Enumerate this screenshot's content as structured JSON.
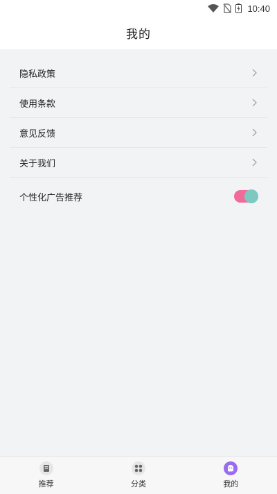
{
  "status_bar": {
    "time": "10:40"
  },
  "header": {
    "title": "我的"
  },
  "menu": {
    "items": [
      {
        "label": "隐私政策"
      },
      {
        "label": "使用条款"
      },
      {
        "label": "意见反馈"
      },
      {
        "label": "关于我们"
      }
    ],
    "toggle": {
      "label": "个性化广告推荐",
      "on": true
    }
  },
  "tabbar": {
    "tabs": [
      {
        "label": "推荐",
        "icon": "book-icon"
      },
      {
        "label": "分类",
        "icon": "grid-icon"
      },
      {
        "label": "我的",
        "icon": "ghost-icon",
        "active": true
      }
    ]
  },
  "colors": {
    "accent": "#9a6cf0",
    "toggle_track": "#f06a9a",
    "toggle_knob": "#7fc8bf"
  }
}
